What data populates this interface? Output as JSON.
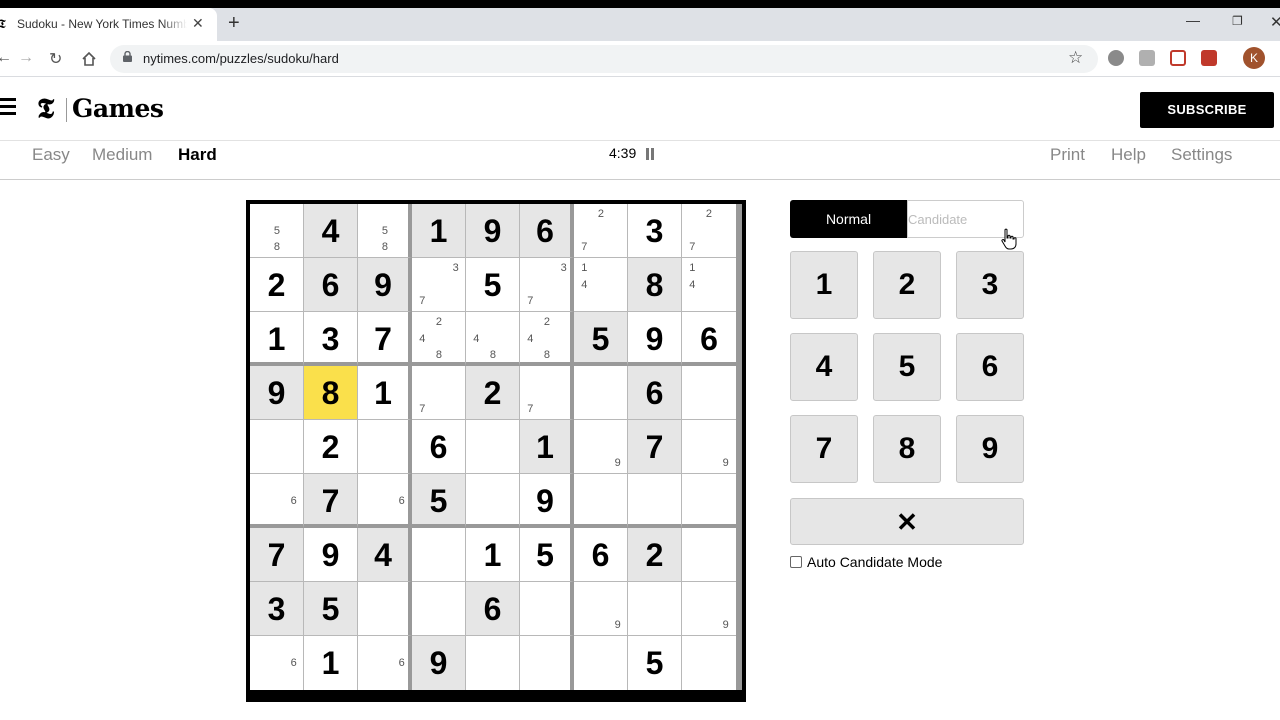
{
  "browser": {
    "tab_title": "Sudoku - New York Times Number Puzzles",
    "tab_favicon": "𝕿",
    "url": "nytimes.com/puzzles/sudoku/hard",
    "avatar_letter": "K"
  },
  "header": {
    "logo_mark": "𝕿",
    "logo_text": "Games",
    "subscribe_label": "SUBSCRIBE"
  },
  "subnav": {
    "levels": [
      "Easy",
      "Medium",
      "Hard"
    ],
    "active_level": "Hard",
    "timer": "4:39",
    "links": [
      "Print",
      "Help",
      "Settings"
    ]
  },
  "board": {
    "selected_cell": [
      3,
      1
    ],
    "cells": [
      [
        {
          "c": [
            5,
            8
          ]
        },
        {
          "v": 4,
          "g": true
        },
        {
          "c": [
            5,
            8
          ]
        },
        {
          "v": 1,
          "g": true
        },
        {
          "v": 9,
          "g": true
        },
        {
          "v": 6,
          "g": true
        },
        {
          "c": [
            2,
            7
          ]
        },
        {
          "v": 3
        },
        {
          "c": [
            2,
            7
          ]
        }
      ],
      [
        {
          "v": 2
        },
        {
          "v": 6,
          "g": true
        },
        {
          "v": 9,
          "g": true
        },
        {
          "c": [
            3,
            7
          ]
        },
        {
          "v": 5
        },
        {
          "c": [
            3,
            7
          ]
        },
        {
          "c": [
            1,
            4
          ]
        },
        {
          "v": 8,
          "g": true
        },
        {
          "c": [
            1,
            4
          ]
        }
      ],
      [
        {
          "v": 1
        },
        {
          "v": 3
        },
        {
          "v": 7
        },
        {
          "c": [
            2,
            4,
            8
          ]
        },
        {
          "c": [
            4,
            8
          ]
        },
        {
          "c": [
            2,
            4,
            8
          ]
        },
        {
          "v": 5,
          "g": true
        },
        {
          "v": 9
        },
        {
          "v": 6
        }
      ],
      [
        {
          "v": 9,
          "g": true
        },
        {
          "v": 8
        },
        {
          "v": 1
        },
        {
          "c": [
            7
          ]
        },
        {
          "v": 2,
          "g": true
        },
        {
          "c": [
            7
          ]
        },
        {},
        {
          "v": 6,
          "g": true
        },
        {}
      ],
      [
        {},
        {
          "v": 2
        },
        {},
        {
          "v": 6
        },
        {},
        {
          "v": 1,
          "g": true
        },
        {
          "c": [
            9
          ]
        },
        {
          "v": 7,
          "g": true
        },
        {
          "c": [
            9
          ]
        }
      ],
      [
        {
          "c": [
            6
          ]
        },
        {
          "v": 7,
          "g": true
        },
        {
          "c": [
            6
          ]
        },
        {
          "v": 5,
          "g": true
        },
        {},
        {
          "v": 9
        },
        {},
        {},
        {}
      ],
      [
        {
          "v": 7,
          "g": true
        },
        {
          "v": 9
        },
        {
          "v": 4,
          "g": true
        },
        {},
        {
          "v": 1
        },
        {
          "v": 5
        },
        {
          "v": 6
        },
        {
          "v": 2,
          "g": true
        },
        {}
      ],
      [
        {
          "v": 3,
          "g": true
        },
        {
          "v": 5,
          "g": true
        },
        {},
        {},
        {
          "v": 6,
          "g": true
        },
        {},
        {
          "c": [
            9
          ]
        },
        {},
        {
          "c": [
            9
          ]
        }
      ],
      [
        {
          "c": [
            6
          ]
        },
        {
          "v": 1
        },
        {
          "c": [
            6
          ]
        },
        {
          "v": 9,
          "g": true
        },
        {},
        {},
        {},
        {
          "v": 5
        },
        {}
      ]
    ]
  },
  "controls": {
    "mode_normal": "Normal",
    "mode_candidate": "Candidate",
    "active_mode": "Normal",
    "keys": [
      "1",
      "2",
      "3",
      "4",
      "5",
      "6",
      "7",
      "8",
      "9"
    ],
    "erase_label": "✕",
    "auto_candidate_label": "Auto Candidate Mode",
    "auto_candidate_checked": false
  },
  "colors": {
    "selected_cell": "#fae04b",
    "given_cell": "#e6e6e6",
    "subscribe_bg": "#000000"
  }
}
